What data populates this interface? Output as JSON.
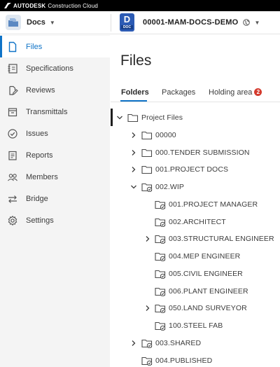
{
  "topbar": {
    "brand": "AUTODESK",
    "product": "Construction Cloud"
  },
  "header": {
    "product_name": "Docs",
    "project_badge_big": "D",
    "project_badge_small": "DOC",
    "project_name": "00001-MAM-DOCS-DEMO"
  },
  "sidebar": {
    "items": [
      {
        "label": "Files",
        "icon": "file-icon",
        "active": true
      },
      {
        "label": "Specifications",
        "icon": "specifications-icon"
      },
      {
        "label": "Reviews",
        "icon": "reviews-icon"
      },
      {
        "label": "Transmittals",
        "icon": "transmittals-icon"
      },
      {
        "label": "Issues",
        "icon": "issues-icon"
      },
      {
        "label": "Reports",
        "icon": "reports-icon"
      },
      {
        "label": "Members",
        "icon": "members-icon"
      },
      {
        "label": "Bridge",
        "icon": "bridge-icon"
      },
      {
        "label": "Settings",
        "icon": "settings-icon"
      }
    ]
  },
  "main": {
    "title": "Files",
    "tabs": [
      {
        "label": "Folders",
        "active": true
      },
      {
        "label": "Packages"
      },
      {
        "label": "Holding area",
        "badge": "2"
      }
    ]
  },
  "tree": [
    {
      "label": "Project Files",
      "level": 0,
      "chevron": "down",
      "folder": "plain"
    },
    {
      "label": "00000",
      "level": 1,
      "chevron": "right",
      "folder": "plain"
    },
    {
      "label": "000.TENDER SUBMISSION",
      "level": 1,
      "chevron": "right",
      "folder": "plain"
    },
    {
      "label": "001.PROJECT DOCS",
      "level": 1,
      "chevron": "right",
      "folder": "plain"
    },
    {
      "label": "002.WIP",
      "level": 1,
      "chevron": "down",
      "folder": "controlled"
    },
    {
      "label": "001.PROJECT MANAGER",
      "level": 2,
      "chevron": "none",
      "folder": "controlled"
    },
    {
      "label": "002.ARCHITECT",
      "level": 2,
      "chevron": "none",
      "folder": "controlled"
    },
    {
      "label": "003.STRUCTURAL ENGINEER",
      "level": 2,
      "chevron": "right",
      "folder": "controlled"
    },
    {
      "label": "004.MEP ENGINEER",
      "level": 2,
      "chevron": "none",
      "folder": "controlled"
    },
    {
      "label": "005.CIVIL ENGINEER",
      "level": 2,
      "chevron": "none",
      "folder": "controlled"
    },
    {
      "label": "006.PLANT ENGINEER",
      "level": 2,
      "chevron": "none",
      "folder": "controlled"
    },
    {
      "label": "050.LAND SURVEYOR",
      "level": 2,
      "chevron": "right",
      "folder": "controlled"
    },
    {
      "label": "100.STEEL FAB",
      "level": 2,
      "chevron": "none",
      "folder": "controlled"
    },
    {
      "label": "003.SHARED",
      "level": 1,
      "chevron": "right",
      "folder": "controlled"
    },
    {
      "label": "004.PUBLISHED",
      "level": 1,
      "chevron": "none",
      "folder": "controlled"
    }
  ],
  "colors": {
    "accent": "#0f73c7",
    "badge": "#d43b2e",
    "sidebar_bg": "#f4f4f4",
    "doc_badge": "#2c5bb4"
  }
}
